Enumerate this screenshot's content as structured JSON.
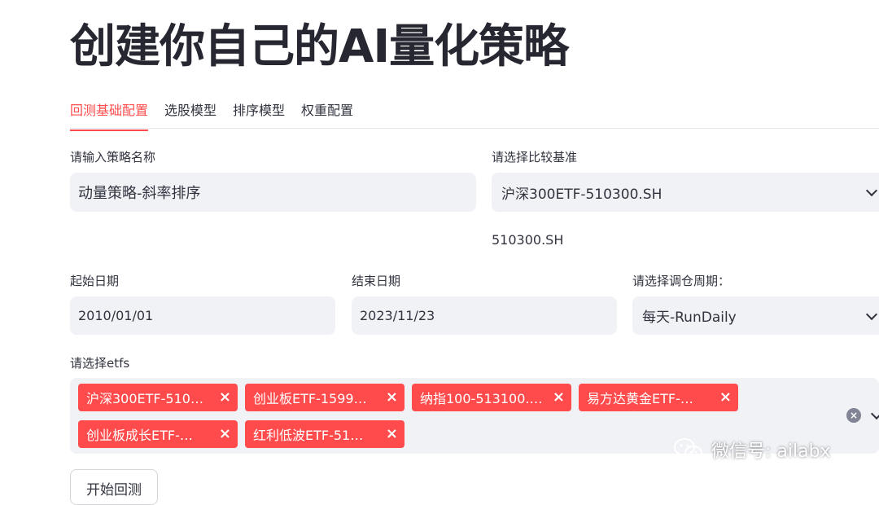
{
  "page": {
    "title": "创建你自己的AI量化策略"
  },
  "tabs": [
    {
      "label": "回测基础配置",
      "active": true
    },
    {
      "label": "选股模型",
      "active": false
    },
    {
      "label": "排序模型",
      "active": false
    },
    {
      "label": "权重配置",
      "active": false
    }
  ],
  "form": {
    "strategy_name": {
      "label": "请输入策略名称",
      "value": "动量策略-斜率排序"
    },
    "benchmark": {
      "label": "请选择比较基准",
      "value": "沪深300ETF-510300.SH",
      "caption": "510300.SH"
    },
    "start_date": {
      "label": "起始日期",
      "value": "2010/01/01"
    },
    "end_date": {
      "label": "结束日期",
      "value": "2023/11/23"
    },
    "rebalance": {
      "label": "请选择调仓周期：",
      "value": "每天-RunDaily"
    },
    "etfs": {
      "label": "请选择etfs",
      "tags": [
        "沪深300ETF-510…",
        "创业板ETF-1599…",
        "纳指100-513100.…",
        "易方达黄金ETF-…",
        "创业板成长ETF-…",
        "红利低波ETF-51…"
      ]
    },
    "run_button": "开始回测"
  },
  "watermark": {
    "text": "微信号: ailabx",
    "icon": "wechat-icon"
  },
  "colors": {
    "accent": "#ff4b4b",
    "input_bg": "#f0f2f6",
    "text": "#31333f"
  }
}
